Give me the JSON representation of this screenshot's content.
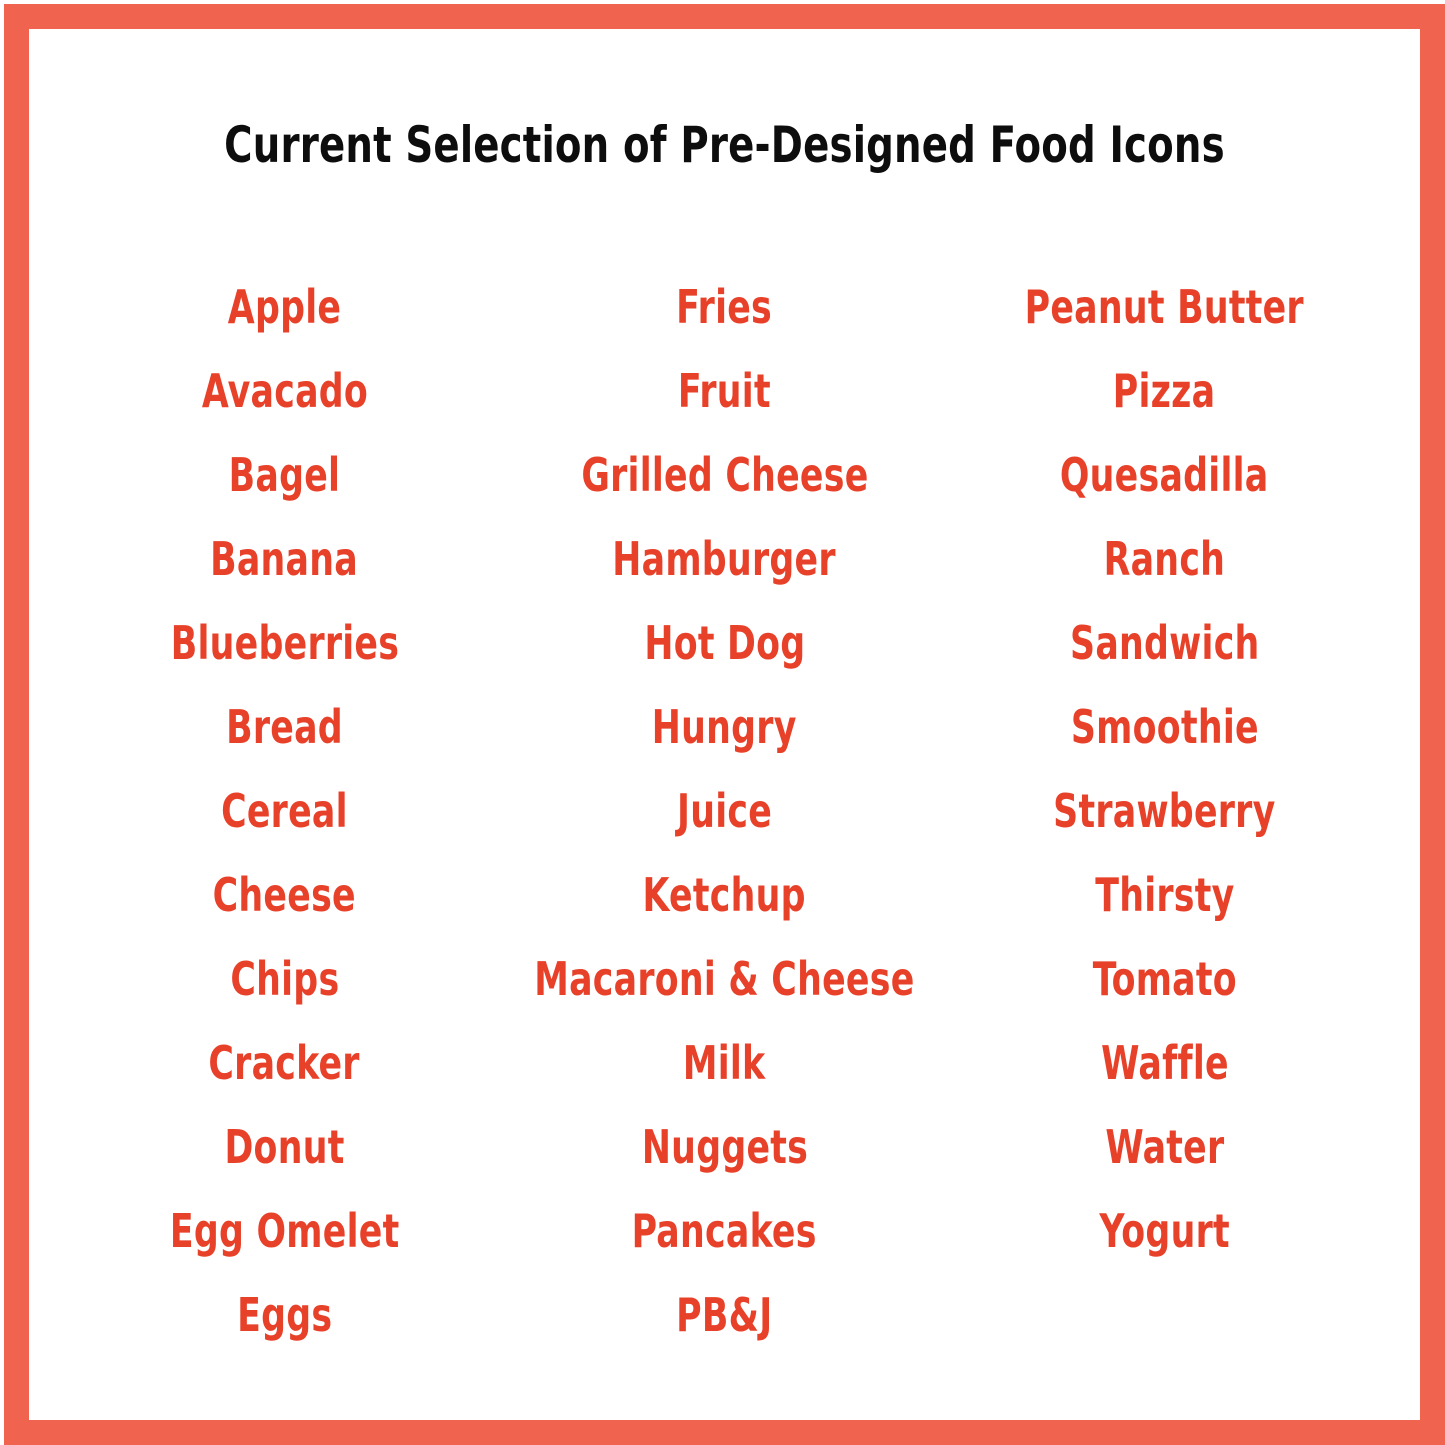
{
  "header": {
    "title": "Current Selection of Pre-Designed Food Icons"
  },
  "colors": {
    "border": "#f0634f",
    "item_text": "#e8412a",
    "title_text": "#0d0d0d",
    "background": "#ffffff"
  },
  "columns": [
    {
      "name": "column-1",
      "items": [
        "Apple",
        "Avacado",
        "Bagel",
        "Banana",
        "Blueberries",
        "Bread",
        "Cereal",
        "Cheese",
        "Chips",
        "Cracker",
        "Donut",
        "Egg Omelet",
        "Eggs"
      ]
    },
    {
      "name": "column-2",
      "items": [
        "Fries",
        "Fruit",
        "Grilled Cheese",
        "Hamburger",
        "Hot Dog",
        "Hungry",
        "Juice",
        "Ketchup",
        "Macaroni & Cheese",
        "Milk",
        "Nuggets",
        "Pancakes",
        "PB&J"
      ]
    },
    {
      "name": "column-3",
      "items": [
        "Peanut Butter",
        "Pizza",
        "Quesadilla",
        "Ranch",
        "Sandwich",
        "Smoothie",
        "Strawberry",
        "Thirsty",
        "Tomato",
        "Waffle",
        "Water",
        "Yogurt"
      ]
    }
  ]
}
